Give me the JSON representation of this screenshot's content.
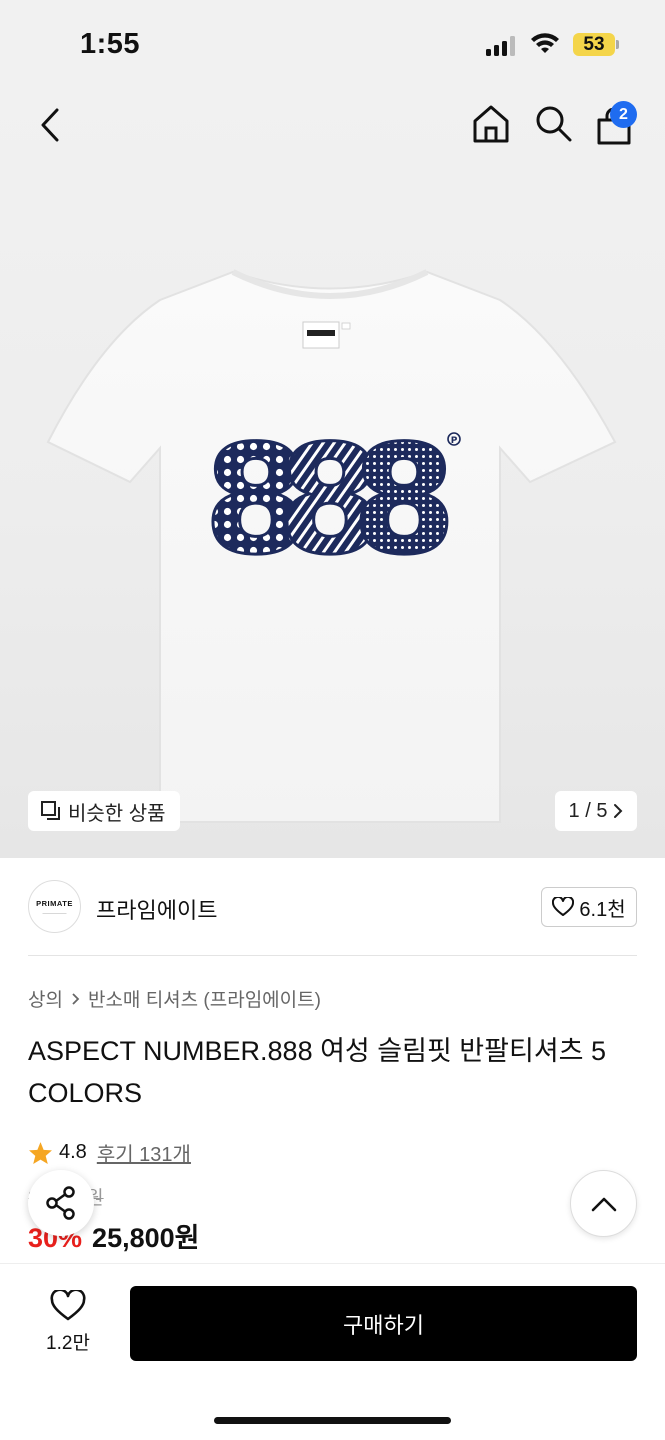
{
  "status_bar": {
    "time": "1:55",
    "battery": "53"
  },
  "header": {
    "cart_count": "2"
  },
  "gallery": {
    "similar_label": "비슷한 상품",
    "pager": "1 / 5",
    "print_text": "888"
  },
  "brand": {
    "logo_text": "PRIMATE",
    "name": "프라임에이트",
    "likes": "6.1천"
  },
  "breadcrumb": [
    "상의",
    "반소매 티셔츠 (프라임에이트)"
  ],
  "product": {
    "title": "ASPECT NUMBER.888 여성 슬림핏 반팔티셔츠 5 COLORS",
    "rating": "4.8",
    "reviews": "후기 131개",
    "original_price": "36,900원",
    "discount": "30%",
    "price": "25,800원"
  },
  "bottom": {
    "wish_count": "1.2만",
    "buy_label": "구매하기"
  },
  "colors": {
    "accent_blue": "#1f6cf0",
    "discount_red": "#e8201c",
    "star": "#f5a623",
    "print_navy": "#1d2a5c"
  }
}
